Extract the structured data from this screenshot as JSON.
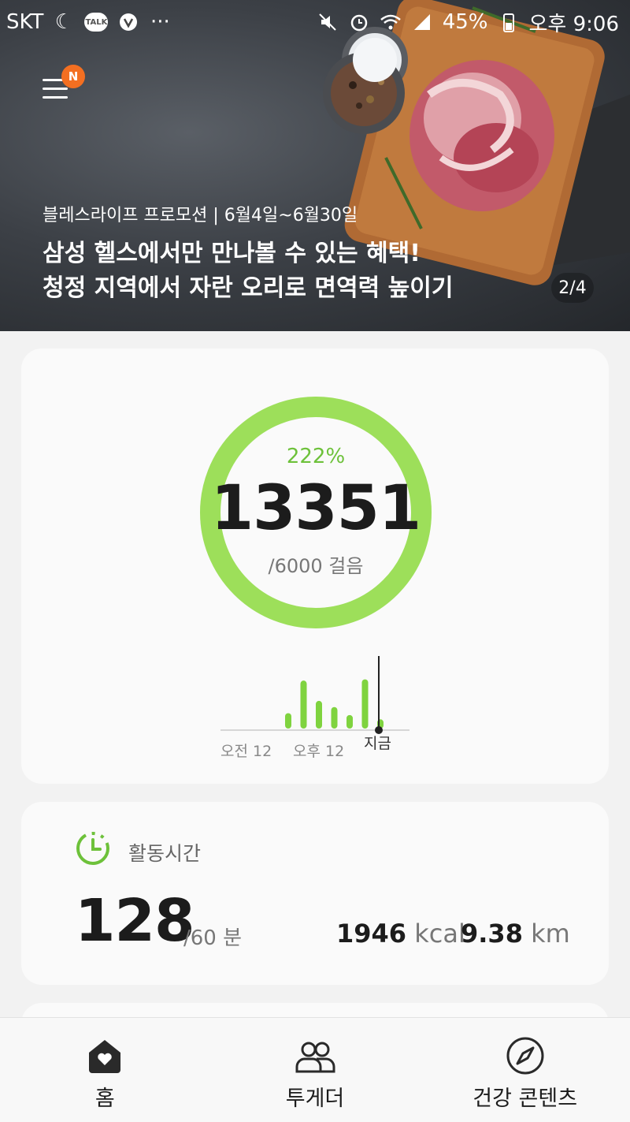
{
  "status_bar": {
    "carrier": "SKT",
    "battery": "45%",
    "time": "오후 9:06",
    "icons": [
      "moon-icon",
      "kakaotalk-icon",
      "v-app-icon",
      "more-icon",
      "mute-icon",
      "alarm-icon",
      "wifi-icon",
      "signal-icon",
      "battery-icon"
    ],
    "talk_label": "TALK"
  },
  "banner": {
    "menu_badge": "N",
    "subtitle": "블레스라이프 프로모션 | 6월4일~6월30일",
    "title_line1": "삼성 헬스에서만 만나볼 수 있는 혜택!",
    "title_line2": "청정 지역에서 자란 오리로 면역력 높이기",
    "page_indicator": "2/4"
  },
  "steps": {
    "percent": "222%",
    "value": "13351",
    "goal": "/6000 걸음",
    "progress_fraction": 1.0,
    "ring_color": "#9ddf5a",
    "chart": {
      "labels": [
        "오전 12",
        "오후 12"
      ],
      "now_label": "지금",
      "bars": [
        0.25,
        0.78,
        0.45,
        0.35,
        0.22,
        0.8,
        0.15
      ]
    }
  },
  "activity": {
    "title": "활동시간",
    "value": "128",
    "goal": "/60 분",
    "kcal_value": "1946",
    "kcal_unit": "kcal",
    "km_value": "9.38",
    "km_unit": "km",
    "accent": "#6dc13a"
  },
  "bottom_nav": [
    {
      "label": "홈",
      "icon": "home-heart-icon"
    },
    {
      "label": "투게더",
      "icon": "people-icon"
    },
    {
      "label": "건강 콘텐츠",
      "icon": "compass-icon"
    }
  ]
}
